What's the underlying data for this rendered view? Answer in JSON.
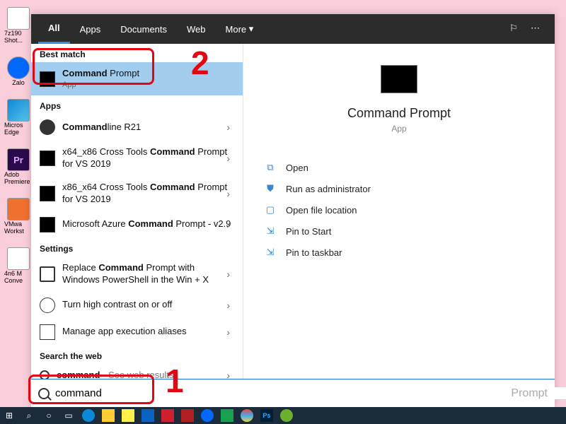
{
  "tabs": {
    "all": "All",
    "apps": "Apps",
    "documents": "Documents",
    "web": "Web",
    "more": "More"
  },
  "sections": {
    "best": "Best match",
    "apps": "Apps",
    "settings": "Settings",
    "web": "Search the web"
  },
  "best": {
    "title_a": "Command",
    "title_b": " Prompt",
    "sub": "App"
  },
  "apps": [
    {
      "a": "Command",
      "b": "line R21"
    },
    {
      "pre": "x64_x86 Cross Tools ",
      "a": "Command",
      "post": " Prompt for VS 2019"
    },
    {
      "pre": "x86_x64 Cross Tools ",
      "a": "Command",
      "post": " Prompt for VS 2019"
    },
    {
      "pre": "Microsoft Azure ",
      "a": "Command",
      "post": " Prompt - v2.9"
    }
  ],
  "settings": [
    {
      "pre": "Replace ",
      "a": "Command",
      "post": " Prompt with Windows PowerShell in the Win + X"
    },
    {
      "text": "Turn high contrast on or off"
    },
    {
      "text": "Manage app execution aliases"
    }
  ],
  "webres": {
    "a": "command",
    "post": " - See web results"
  },
  "preview": {
    "title": "Command Prompt",
    "type": "App"
  },
  "actions": {
    "open": "Open",
    "admin": "Run as administrator",
    "loc": "Open file location",
    "pinstart": "Pin to Start",
    "pintask": "Pin to taskbar"
  },
  "search": {
    "value": "command ",
    "placeholder": "Prompt"
  },
  "desktop": {
    "d1": "7z190 Shot...",
    "d2": "Zalo",
    "d3": "Micros Edge",
    "d4": "Adob Premiere",
    "d5": "VMwa Workst",
    "d6": "4n6 M Conve"
  },
  "annot": {
    "n1": "1",
    "n2": "2"
  }
}
